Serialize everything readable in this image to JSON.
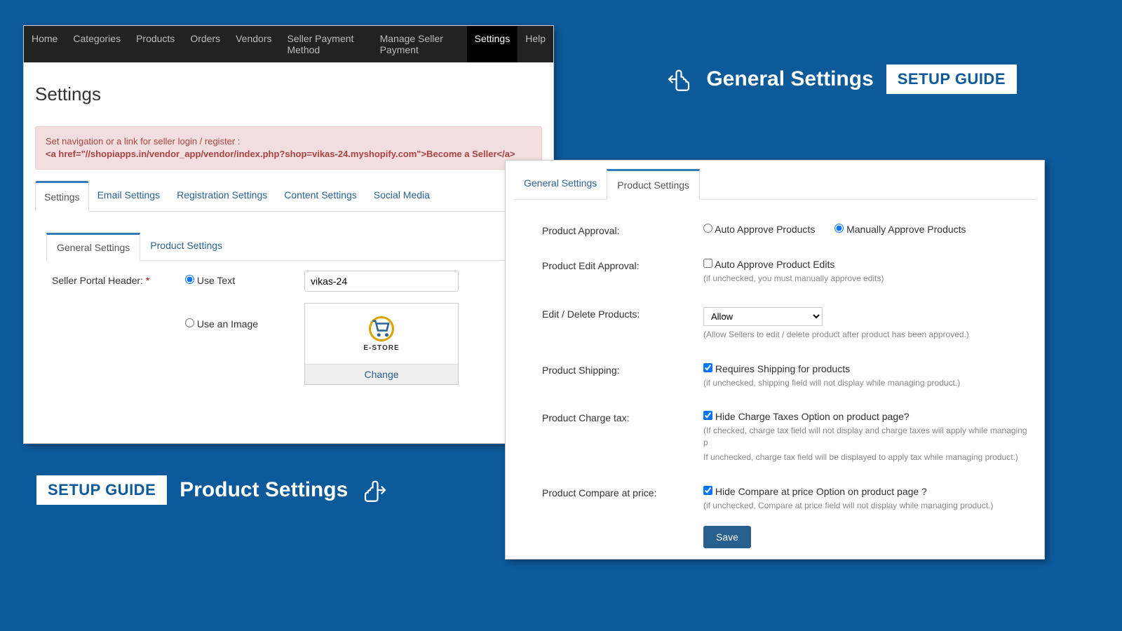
{
  "nav": {
    "items": [
      "Home",
      "Categories",
      "Products",
      "Orders",
      "Vendors",
      "Seller Payment Method",
      "Manage Seller Payment",
      "Settings",
      "Help"
    ],
    "active": 7
  },
  "page_title": "Settings",
  "alert": {
    "line1": "Set navigation or a link for seller login / register :",
    "line2": "<a href=\"//shopiapps.in/vendor_app/vendor/index.php?shop=vikas-24.myshopify.com\">Become a Seller</a>"
  },
  "tabs1": {
    "items": [
      "Settings",
      "Email Settings",
      "Registration Settings",
      "Content Settings",
      "Social Media"
    ],
    "active": 0
  },
  "tabs2": {
    "items": [
      "General Settings",
      "Product Settings"
    ],
    "active": 0
  },
  "form": {
    "label": "Seller Portal Header:",
    "opt_text": "Use Text",
    "opt_image": "Use an Image",
    "text_value": "vikas-24",
    "change": "Change",
    "logo_text": "E-STORE"
  },
  "hdr_right": {
    "title": "General Settings",
    "badge": "SETUP GUIDE"
  },
  "hdr_left": {
    "badge": "SETUP GUIDE",
    "title": "Product Settings"
  },
  "tabs3": {
    "items": [
      "General Settings",
      "Product Settings"
    ],
    "active": 1
  },
  "p2": {
    "approval_label": "Product Approval:",
    "approval_auto": "Auto Approve Products",
    "approval_manual": "Manually Approve Products",
    "edit_approval_label": "Product Edit Approval:",
    "edit_approval_cb": "Auto Approve Product Edits",
    "edit_approval_hint": "(if unchecked, you must manually approve edits)",
    "editdel_label": "Edit / Delete Products:",
    "editdel_value": "Allow",
    "editdel_hint": "(Allow Sellers to edit / delete product after product has been approved.)",
    "shipping_label": "Product Shipping:",
    "shipping_cb": "Requires Shipping for products",
    "shipping_hint": "(if unchecked, shipping field will not display while managing product.)",
    "tax_label": "Product Charge tax:",
    "tax_cb": "Hide Charge Taxes Option on product page?",
    "tax_hint1": "(If checked, charge tax field will not display and charge taxes will apply while managing p",
    "tax_hint2": "If unchecked, charge tax field will be displayed to apply tax while managing product.)",
    "compare_label": "Product Compare at price:",
    "compare_cb": "Hide Compare at price Option on product page ?",
    "compare_hint": "(if unchecked, Compare at price field will not display while managing product.)",
    "save": "Save"
  }
}
